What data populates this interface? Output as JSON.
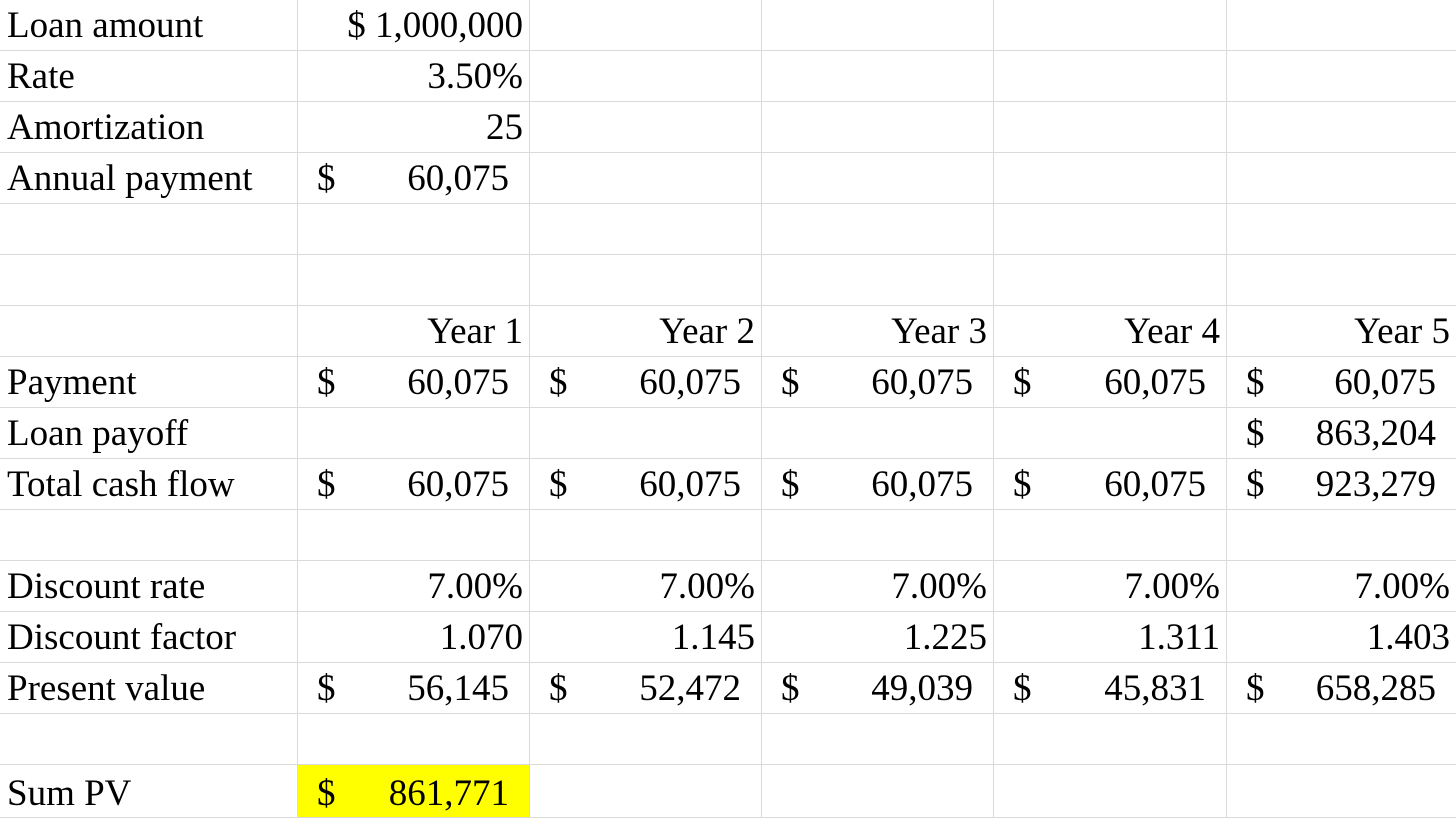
{
  "sheet": {
    "loan_amount": {
      "label": "Loan amount",
      "value": "$ 1,000,000"
    },
    "rate": {
      "label": "Rate",
      "value": "3.50%"
    },
    "amortization": {
      "label": "Amortization",
      "value": "25"
    },
    "annual_payment": {
      "label": "Annual payment",
      "currency": "$",
      "value": "60,075"
    },
    "years": [
      "Year 1",
      "Year 2",
      "Year 3",
      "Year 4",
      "Year 5"
    ],
    "payment": {
      "label": "Payment",
      "currency": "$",
      "values": [
        "60,075",
        "60,075",
        "60,075",
        "60,075",
        "60,075"
      ]
    },
    "loan_payoff": {
      "label": "Loan payoff",
      "currency": "$",
      "year5": "863,204"
    },
    "total_cash_flow": {
      "label": "Total cash flow",
      "currency": "$",
      "values": [
        "60,075",
        "60,075",
        "60,075",
        "60,075",
        "923,279"
      ]
    },
    "discount_rate": {
      "label": "Discount rate",
      "values": [
        "7.00%",
        "7.00%",
        "7.00%",
        "7.00%",
        "7.00%"
      ]
    },
    "discount_factor": {
      "label": "Discount factor",
      "values": [
        "1.070",
        "1.145",
        "1.225",
        "1.311",
        "1.403"
      ]
    },
    "present_value": {
      "label": "Present value",
      "currency": "$",
      "values": [
        "56,145",
        "52,472",
        "49,039",
        "45,831",
        "658,285"
      ]
    },
    "sum_pv": {
      "label": "Sum PV",
      "currency": "$",
      "value": "861,771",
      "highlight_color": "#ffff00"
    }
  }
}
